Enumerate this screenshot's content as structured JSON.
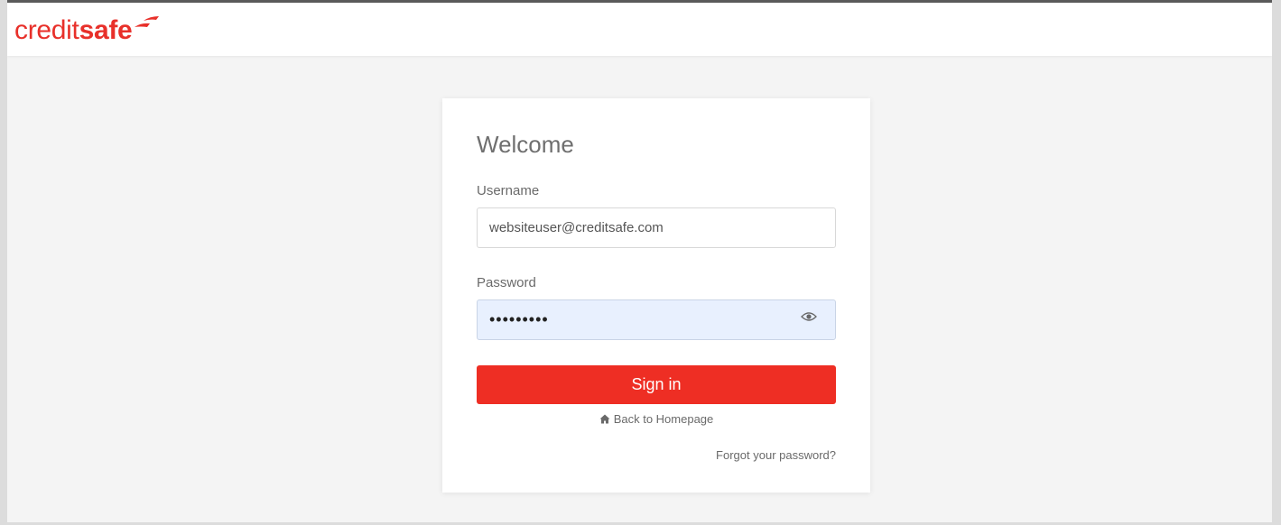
{
  "brand": {
    "name_light": "credit",
    "name_bold": "safe",
    "color": "#e8302a"
  },
  "login": {
    "title": "Welcome",
    "username_label": "Username",
    "username_value": "websiteuser@creditsafe.com",
    "password_label": "Password",
    "password_value": "•••••••••",
    "password_toggle_icon": "eye-icon",
    "signin_label": "Sign in",
    "signin_color": "#ee2e24",
    "home_icon": "home-icon",
    "home_link_label": "Back to Homepage",
    "forgot_label": "Forgot your password?"
  }
}
